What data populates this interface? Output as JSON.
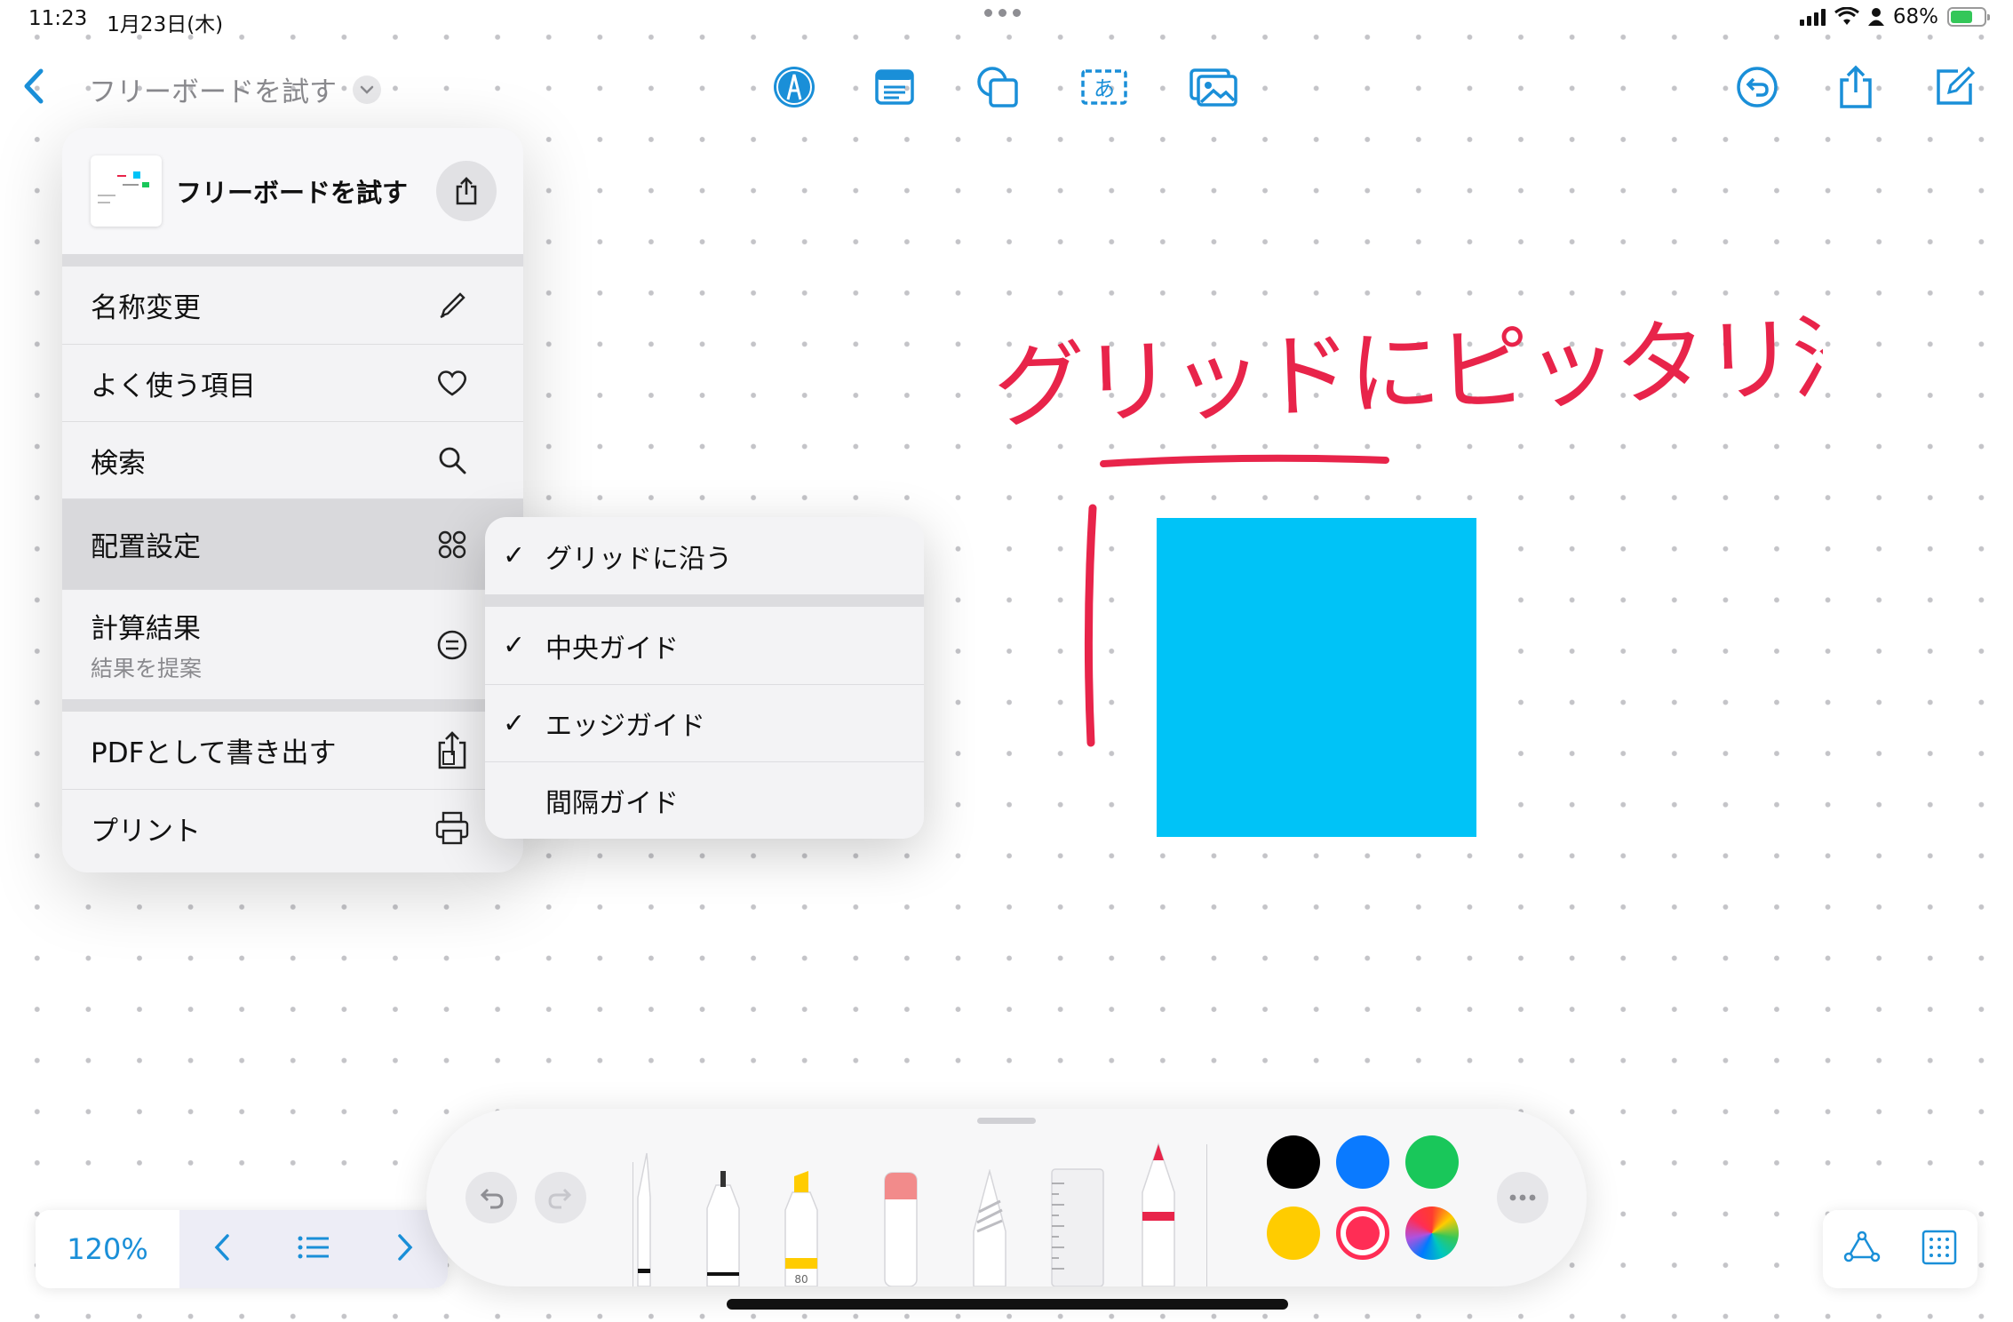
{
  "status": {
    "time": "11:23",
    "date": "1月23日(木)",
    "battery_text": "68%",
    "battery_level": 0.68
  },
  "nav": {
    "title": "フリーボードを試す"
  },
  "menu": {
    "header_title": "フリーボードを試す",
    "items": [
      {
        "label": "名称変更",
        "icon": "pencil-icon"
      },
      {
        "label": "よく使う項目",
        "icon": "heart-icon"
      },
      {
        "label": "検索",
        "icon": "search-icon"
      },
      {
        "label": "配置設定",
        "icon": "grid-arrange-icon"
      },
      {
        "label": "計算結果",
        "sublabel": "結果を提案",
        "icon": "equals-circle-icon"
      },
      {
        "label": "PDFとして書き出す",
        "icon": "export-icon"
      },
      {
        "label": "プリント",
        "icon": "printer-icon"
      }
    ]
  },
  "submenu": {
    "items": [
      {
        "label": "グリッドに沿う",
        "checked": true
      },
      {
        "label": "中央ガイド",
        "checked": true
      },
      {
        "label": "エッジガイド",
        "checked": true
      },
      {
        "label": "間隔ガイド",
        "checked": false
      }
    ]
  },
  "canvas": {
    "handwriting": "グリッドにピッタリ沿う"
  },
  "bottom": {
    "zoom": "120%"
  },
  "palette": {
    "marker_label": "80",
    "colors": [
      "#000000",
      "#0a7aff",
      "#19c75a",
      "#ffcc00",
      "#ff2d55"
    ],
    "selected_color": "#ff2d55"
  },
  "colors": {
    "accent": "#1a8fd8",
    "square": "#00c3f7",
    "ink": "#e8244a"
  }
}
